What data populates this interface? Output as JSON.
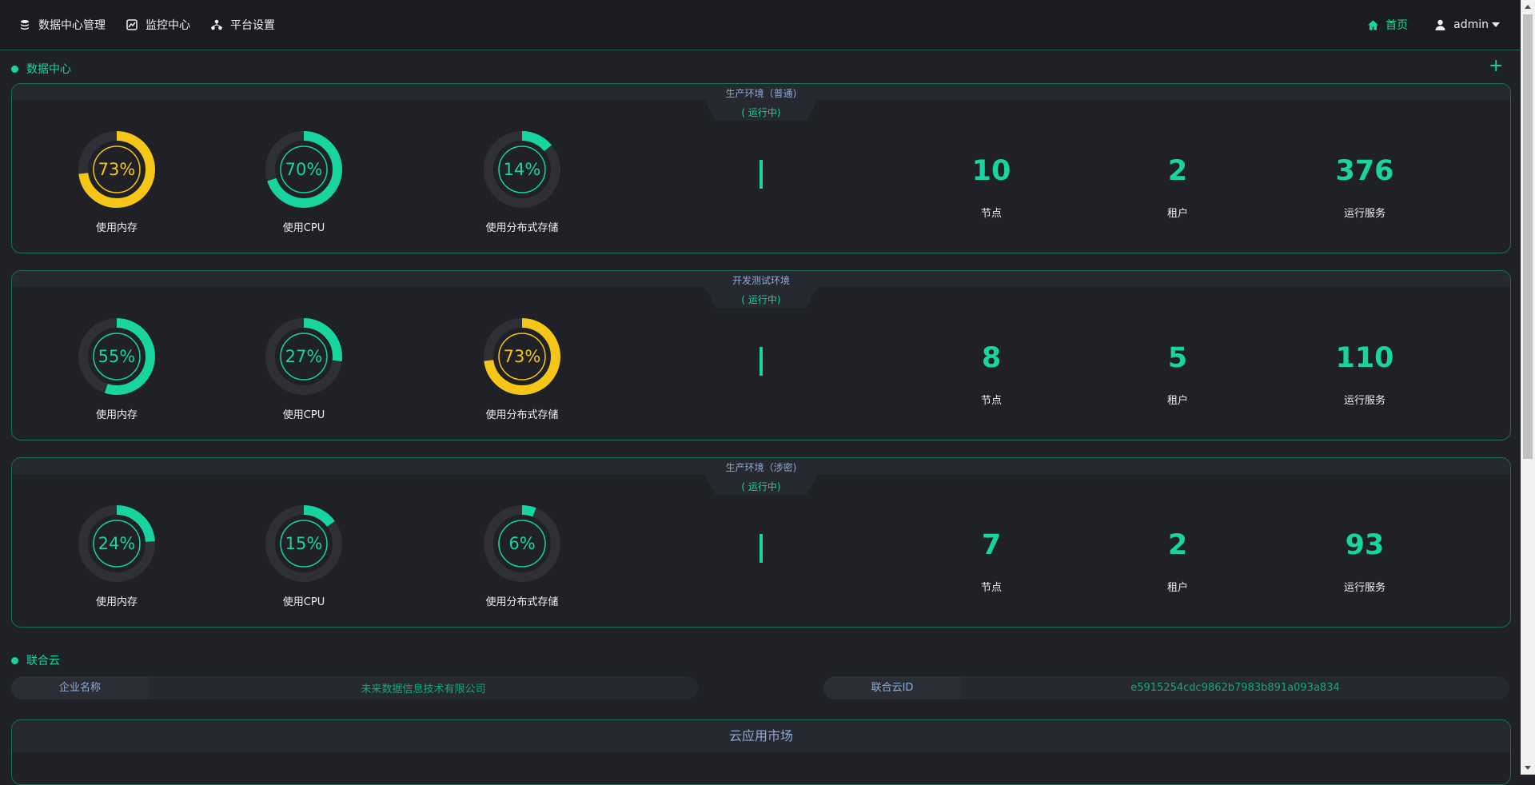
{
  "nav": {
    "items": [
      {
        "label": "数据中心管理",
        "icon": "database-icon"
      },
      {
        "label": "监控中心",
        "icon": "chart-icon"
      },
      {
        "label": "平台设置",
        "icon": "sitemap-icon"
      }
    ],
    "home_label": "首页",
    "user_label": "admin"
  },
  "datacenter": {
    "title": "数据中心",
    "add_symbol": "+",
    "environments": [
      {
        "name": "生产环境（普通)",
        "status": "( 运行中)",
        "gauges": [
          {
            "label": "使用内存",
            "percent": 73,
            "display": "73%",
            "color": "#f5c518"
          },
          {
            "label": "使用CPU",
            "percent": 70,
            "display": "70%",
            "color": "#17d4a1"
          },
          {
            "label": "使用分布式存储",
            "percent": 14,
            "display": "14%",
            "color": "#17d4a1"
          }
        ],
        "stats": [
          {
            "value": "10",
            "label": "节点"
          },
          {
            "value": "2",
            "label": "租户"
          },
          {
            "value": "376",
            "label": "运行服务"
          }
        ]
      },
      {
        "name": "开发测试环境",
        "status": "( 运行中)",
        "gauges": [
          {
            "label": "使用内存",
            "percent": 55,
            "display": "55%",
            "color": "#17d4a1"
          },
          {
            "label": "使用CPU",
            "percent": 27,
            "display": "27%",
            "color": "#17d4a1"
          },
          {
            "label": "使用分布式存储",
            "percent": 73,
            "display": "73%",
            "color": "#f5c518"
          }
        ],
        "stats": [
          {
            "value": "8",
            "label": "节点"
          },
          {
            "value": "5",
            "label": "租户"
          },
          {
            "value": "110",
            "label": "运行服务"
          }
        ]
      },
      {
        "name": "生产环境（涉密)",
        "status": "( 运行中)",
        "gauges": [
          {
            "label": "使用内存",
            "percent": 24,
            "display": "24%",
            "color": "#17d4a1"
          },
          {
            "label": "使用CPU",
            "percent": 15,
            "display": "15%",
            "color": "#17d4a1"
          },
          {
            "label": "使用分布式存储",
            "percent": 6,
            "display": "6%",
            "color": "#17d4a1"
          }
        ],
        "stats": [
          {
            "value": "7",
            "label": "节点"
          },
          {
            "value": "2",
            "label": "租户"
          },
          {
            "value": "93",
            "label": "运行服务"
          }
        ]
      }
    ]
  },
  "federation": {
    "title": "联合云",
    "company_key": "企业名称",
    "company_value": "未来数据信息技术有限公司",
    "cloud_id_key": "联合云ID",
    "cloud_id_value": "e5915254cdc9862b7983b891a093a834"
  },
  "market": {
    "title": "云应用市场"
  },
  "colors": {
    "accent": "#17d4a1",
    "warning": "#f5c518",
    "border": "#1a6e52",
    "muted_text": "#8fa8d8"
  }
}
